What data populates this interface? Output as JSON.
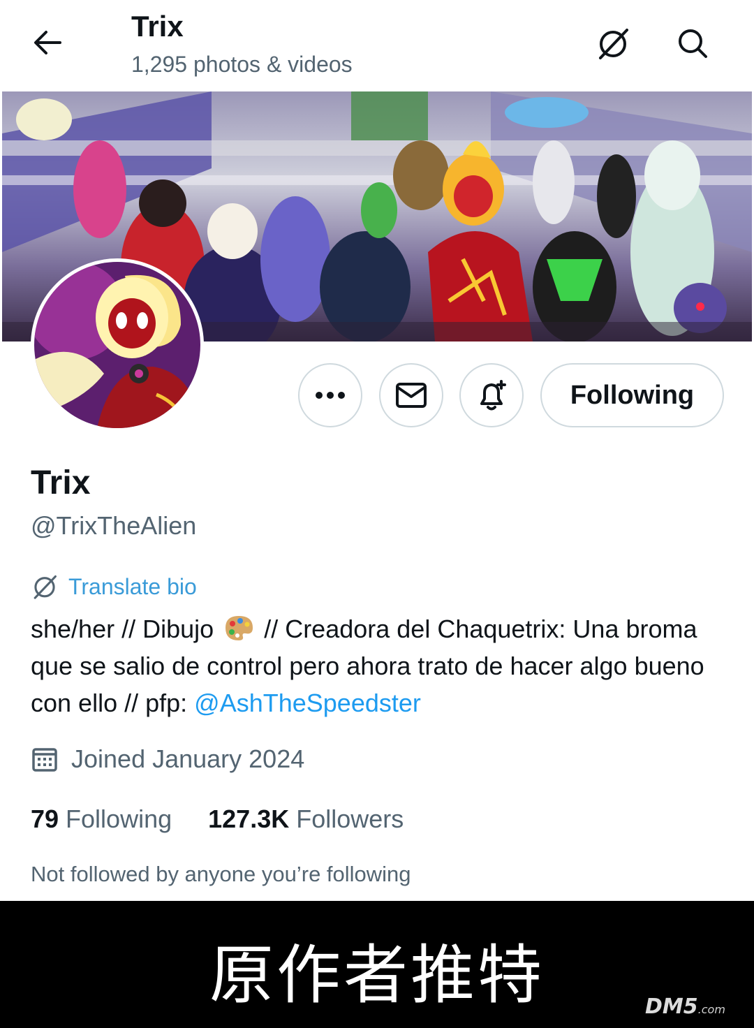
{
  "header": {
    "title": "Trix",
    "subtitle": "1,295 photos & videos",
    "back_icon": "arrow-left-icon",
    "translate_icon": "no-translate-icon",
    "search_icon": "search-icon"
  },
  "actions": {
    "more_icon": "more-dots-icon",
    "message_icon": "envelope-icon",
    "notify_icon": "bell-plus-icon",
    "follow_label": "Following"
  },
  "profile": {
    "name": "Trix",
    "handle": "@TrixTheAlien",
    "translate_label": "Translate bio",
    "bio_part1": "she/her // Dibujo",
    "bio_part2": "// Creadora del Chaquetrix: Una broma que se salio de control pero ahora trato de hacer algo bueno con ello // pfp:",
    "bio_mention": "@AshTheSpeedster",
    "joined": "Joined January 2024",
    "following_count": "79",
    "following_label": "Following",
    "followers_count": "127.3K",
    "followers_label": "Followers",
    "not_followed": "Not followed by anyone you’re following"
  },
  "caption": {
    "text": "原作者推特",
    "watermark_main": "DM5",
    "watermark_suffix": ".com"
  },
  "colors": {
    "accent": "#1d9bf0",
    "text_primary": "#0f1419",
    "text_secondary": "#536471",
    "border": "#cfd9de"
  }
}
